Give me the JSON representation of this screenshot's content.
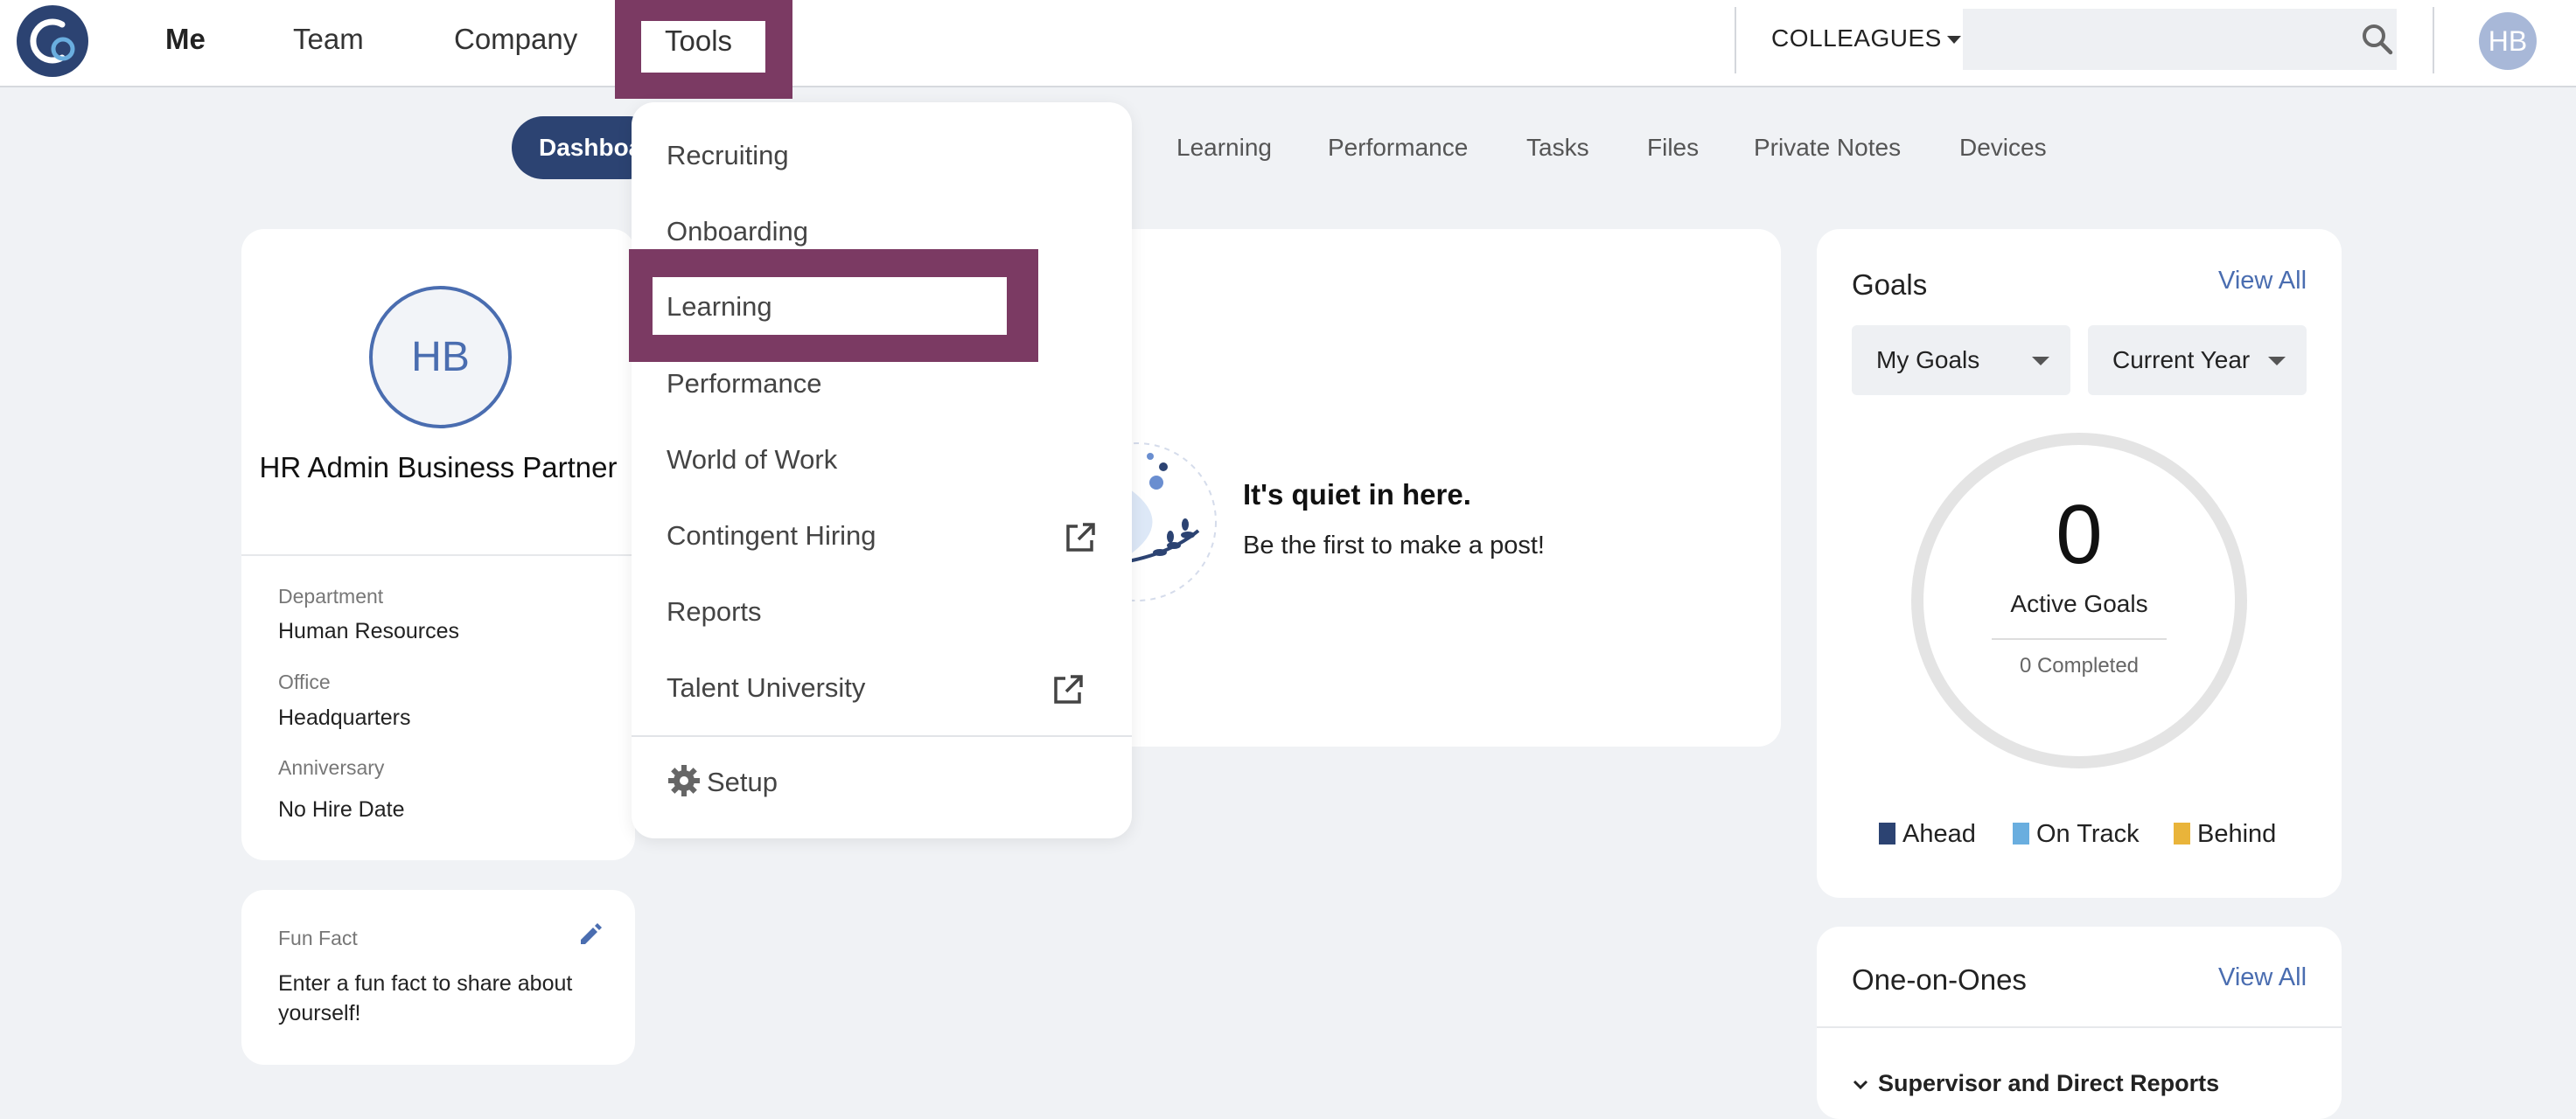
{
  "topnav": {
    "items": [
      "Me",
      "Team",
      "Company"
    ],
    "tools_label": "Tools",
    "colleagues_label": "COLLEAGUES",
    "search_placeholder": "",
    "user_initials": "HB"
  },
  "subnav": {
    "active_tab": "Dashboa",
    "tabs": [
      "Learning",
      "Performance",
      "Tasks",
      "Files",
      "Private Notes",
      "Devices"
    ]
  },
  "profile": {
    "initials": "HB",
    "name": "HR Admin Business Partner",
    "fields": [
      {
        "label": "Department",
        "value": "Human Resources"
      },
      {
        "label": "Office",
        "value": "Headquarters"
      },
      {
        "label": "Anniversary",
        "value": "No Hire Date"
      }
    ]
  },
  "funfact": {
    "label": "Fun Fact",
    "text": "Enter a fun fact to share about yourself!"
  },
  "feed": {
    "empty_title": "It's quiet in here.",
    "empty_subtitle": "Be the first to make a post!"
  },
  "goals": {
    "title": "Goals",
    "view_all": "View All",
    "filter_owner": "My Goals",
    "filter_period": "Current Year",
    "active_count": "0",
    "active_label": "Active Goals",
    "completed": "0 Completed",
    "legend": [
      {
        "label": "Ahead",
        "color": "#2c4372"
      },
      {
        "label": "On Track",
        "color": "#6aaedf"
      },
      {
        "label": "Behind",
        "color": "#e9b43a"
      }
    ]
  },
  "oneonones": {
    "title": "One-on-Ones",
    "view_all": "View All",
    "section": "Supervisor and Direct Reports"
  },
  "tools_menu": {
    "items": [
      {
        "label": "Recruiting",
        "external": false
      },
      {
        "label": "Onboarding",
        "external": false
      },
      {
        "label": "Learning",
        "external": false,
        "highlighted": true
      },
      {
        "label": "Performance",
        "external": false
      },
      {
        "label": "World of Work",
        "external": false
      },
      {
        "label": "Contingent Hiring",
        "external": true
      },
      {
        "label": "Reports",
        "external": false
      },
      {
        "label": "Talent University",
        "external": true
      }
    ],
    "setup_label": "Setup"
  },
  "colors": {
    "brand_navy": "#2c4372",
    "highlight": "#7b3a63",
    "link_blue": "#4a6db0"
  }
}
